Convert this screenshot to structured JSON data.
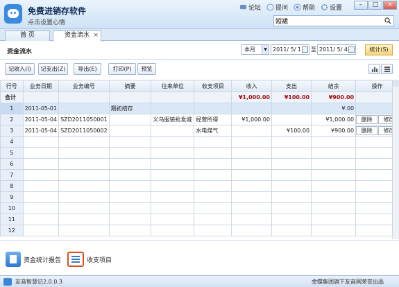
{
  "app": {
    "title": "免费进销存软件",
    "subtitle": "点击设置心情"
  },
  "toplinks": [
    {
      "label": "论坛",
      "icon": "forum-icon"
    },
    {
      "label": "提问",
      "icon": "question-icon"
    },
    {
      "label": "帮助",
      "icon": "help-icon"
    },
    {
      "label": "设置",
      "icon": "settings-icon"
    }
  ],
  "search": {
    "value": "短裙"
  },
  "tabs": [
    {
      "label": "首 页"
    },
    {
      "label": "资金流水"
    }
  ],
  "page": {
    "title": "资金流水"
  },
  "filter": {
    "period": "本月",
    "date_from": "2011/ 5/ 1",
    "date_to": "2011/ 5/ 4",
    "to_label": "至",
    "stat_button": "统计(S)"
  },
  "actions": {
    "income": "记收入(I)",
    "expense": "记支出(Z)",
    "export": "导出(E)",
    "print": "打印(P)",
    "preview": "预览"
  },
  "table": {
    "headers": [
      "行号",
      "业务日期",
      "业务编号",
      "摘要",
      "往来单位",
      "收支项目",
      "收入",
      "支出",
      "结余",
      "操作"
    ],
    "total": {
      "label": "合计",
      "income": "¥1,000.00",
      "expense": "¥100.00",
      "balance": "¥900.00"
    },
    "rows": [
      {
        "no": "1",
        "date": "2011-05-01",
        "code": "",
        "summary": "期初结存",
        "party": "",
        "item": "",
        "income": "",
        "expense": "",
        "balance": "¥.00",
        "ops": false
      },
      {
        "no": "2",
        "date": "2011-05-04",
        "code": "SZD2011050001",
        "summary": "",
        "party": "义乌服装批发城",
        "item": "经营所得",
        "income": "¥1,000.00",
        "expense": "",
        "balance": "¥1,000.00",
        "ops": true
      },
      {
        "no": "3",
        "date": "2011-05-04",
        "code": "SZD2011050002",
        "summary": "",
        "party": "",
        "item": "水电煤气",
        "income": "",
        "expense": "¥100.00",
        "balance": "¥900.00",
        "ops": true
      },
      {
        "no": "4"
      },
      {
        "no": "5"
      },
      {
        "no": "6"
      },
      {
        "no": "7"
      },
      {
        "no": "8"
      },
      {
        "no": "9"
      },
      {
        "no": "10"
      },
      {
        "no": "11"
      },
      {
        "no": "12"
      }
    ],
    "op_delete": "删除",
    "op_edit": "修改"
  },
  "bottom": {
    "report": "资金统计报告",
    "items": "收支项目"
  },
  "status": {
    "version": "友商智慧记2.0.0.3",
    "copyright": "金蝶集团旗下友商网荣誉出品"
  }
}
